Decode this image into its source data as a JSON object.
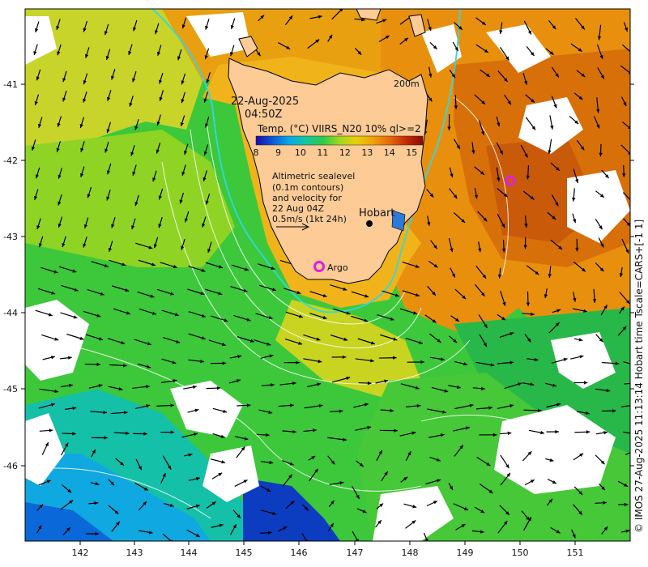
{
  "date": "22-Aug-2025",
  "time": "04:50Z",
  "colorbar": {
    "title": "Temp. (°C) VIIRS_N20 10% ql>=2",
    "ticks": [
      "8",
      "9",
      "10",
      "11",
      "12",
      "13",
      "14",
      "15"
    ],
    "range": [
      8,
      15.5
    ],
    "colors": [
      "#1c0aa8",
      "#0a5ad6",
      "#0aa8e6",
      "#12c8a0",
      "#2ec84a",
      "#9ed820",
      "#e8d00a",
      "#f0a20a",
      "#e66a0a",
      "#c42a0a",
      "#8a0a0a"
    ]
  },
  "legend": {
    "lines": [
      "Altimetric sealevel",
      "(0.1m contours)",
      "and velocity for",
      "22 Aug 04Z",
      "0.5m/s (1kt 24h)"
    ]
  },
  "depth_label": "200m",
  "places": {
    "hobart": "Hobart",
    "argo": "Argo"
  },
  "axes": {
    "lon_ticks": [
      "142",
      "143",
      "144",
      "145",
      "146",
      "147",
      "148",
      "149",
      "150",
      "151"
    ],
    "lat_ticks": [
      "-41",
      "-42",
      "-43",
      "-44",
      "-45",
      "-46"
    ]
  },
  "credit": "© IMOS 27-Aug-2025 11:13:14 Hobart time Tscale=CARS+[-1 1]",
  "colors": {
    "land": "#fccb96",
    "shelf_line": "#2ed8e6",
    "argo_marker": "#e020e0",
    "velocity_arrow": "#000000"
  }
}
